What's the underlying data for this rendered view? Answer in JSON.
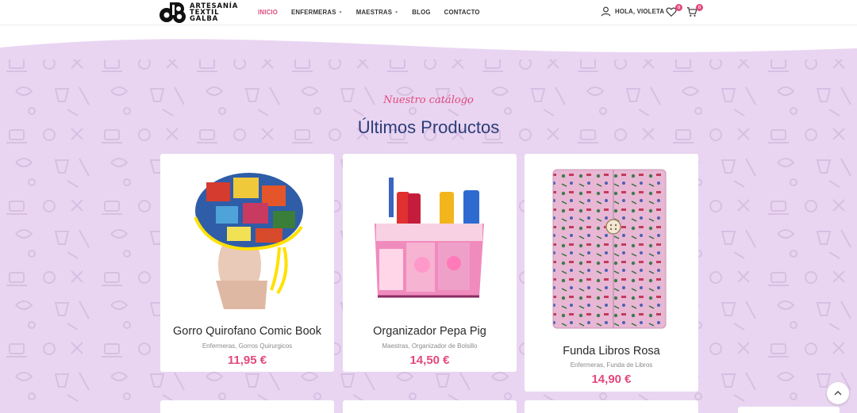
{
  "brand": {
    "logo_lines": [
      "ARTESANÍA",
      "TEXTIL",
      "GALBA"
    ],
    "accent_color": "#e2497e",
    "title_color": "#2b3d78",
    "background_color": "#e9d5f1"
  },
  "nav": {
    "items": [
      {
        "label": "INICIO",
        "active": true,
        "has_dropdown": false
      },
      {
        "label": "ENFERMERAS",
        "active": false,
        "has_dropdown": true
      },
      {
        "label": "MAESTRAS",
        "active": false,
        "has_dropdown": true
      },
      {
        "label": "BLOG",
        "active": false,
        "has_dropdown": false
      },
      {
        "label": "CONTACTO",
        "active": false,
        "has_dropdown": false
      }
    ]
  },
  "header_actions": {
    "user_label": "HOLA, VIOLETA",
    "wishlist_count": "0",
    "cart_count": "0",
    "icons": [
      "user-icon",
      "heart-icon",
      "cart-icon"
    ]
  },
  "section": {
    "subtitle": "Nuestro catálogo",
    "title": "Últimos Productos"
  },
  "products": [
    {
      "name": "Gorro Quirofano Comic Book",
      "categories": "Enfermeras, Gorros Quirurgicos",
      "price": "11,95 €"
    },
    {
      "name": "Organizador Pepa Pig",
      "categories": "Maestras, Organizador de Bolsillo",
      "price": "14,50 €"
    },
    {
      "name": "Funda Libros Rosa",
      "categories": "Enfermeras, Funda de Libros",
      "price": "14,90 €"
    }
  ],
  "scroll_top_icon": "chevron-up-icon"
}
